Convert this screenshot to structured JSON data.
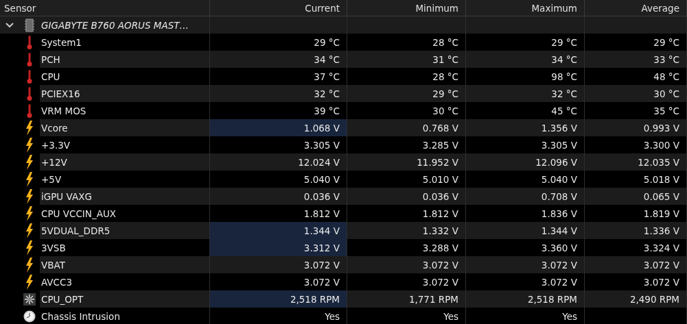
{
  "columns": [
    "Sensor",
    "Current",
    "Minimum",
    "Maximum",
    "Average"
  ],
  "groups": [
    {
      "name": "GIGABYTE B760 AORUS MAST…",
      "expanded": true,
      "children": [
        {
          "kind": "temperature",
          "name": "System1",
          "values": [
            "29 °C",
            "28 °C",
            "29 °C",
            "29 °C"
          ],
          "highlighted": false
        },
        {
          "kind": "temperature",
          "name": "PCH",
          "values": [
            "34 °C",
            "31 °C",
            "34 °C",
            "33 °C"
          ],
          "highlighted": false
        },
        {
          "kind": "temperature",
          "name": "CPU",
          "values": [
            "37 °C",
            "28 °C",
            "98 °C",
            "48 °C"
          ],
          "highlighted": false
        },
        {
          "kind": "temperature",
          "name": "PCIEX16",
          "values": [
            "32 °C",
            "29 °C",
            "32 °C",
            "30 °C"
          ],
          "highlighted": false
        },
        {
          "kind": "temperature",
          "name": "VRM MOS",
          "values": [
            "39 °C",
            "30 °C",
            "45 °C",
            "35 °C"
          ],
          "highlighted": false
        },
        {
          "kind": "voltage",
          "name": "Vcore",
          "values": [
            "1.068 V",
            "0.768 V",
            "1.356 V",
            "0.993 V"
          ],
          "highlighted": true
        },
        {
          "kind": "voltage",
          "name": "+3.3V",
          "values": [
            "3.305 V",
            "3.285 V",
            "3.305 V",
            "3.300 V"
          ],
          "highlighted": false
        },
        {
          "kind": "voltage",
          "name": "+12V",
          "values": [
            "12.024 V",
            "11.952 V",
            "12.096 V",
            "12.035 V"
          ],
          "highlighted": false
        },
        {
          "kind": "voltage",
          "name": "+5V",
          "values": [
            "5.040 V",
            "5.010 V",
            "5.040 V",
            "5.018 V"
          ],
          "highlighted": false
        },
        {
          "kind": "voltage",
          "name": "iGPU VAXG",
          "values": [
            "0.036 V",
            "0.036 V",
            "0.708 V",
            "0.065 V"
          ],
          "highlighted": false
        },
        {
          "kind": "voltage",
          "name": "CPU VCCIN_AUX",
          "values": [
            "1.812 V",
            "1.812 V",
            "1.836 V",
            "1.819 V"
          ],
          "highlighted": false
        },
        {
          "kind": "voltage",
          "name": "5VDUAL_DDR5",
          "values": [
            "1.344 V",
            "1.332 V",
            "1.344 V",
            "1.336 V"
          ],
          "highlighted": true
        },
        {
          "kind": "voltage",
          "name": "3VSB",
          "values": [
            "3.312 V",
            "3.288 V",
            "3.360 V",
            "3.324 V"
          ],
          "highlighted": true
        },
        {
          "kind": "voltage",
          "name": "VBAT",
          "values": [
            "3.072 V",
            "3.072 V",
            "3.072 V",
            "3.072 V"
          ],
          "highlighted": false
        },
        {
          "kind": "voltage",
          "name": "AVCC3",
          "values": [
            "3.072 V",
            "3.072 V",
            "3.072 V",
            "3.072 V"
          ],
          "highlighted": false
        },
        {
          "kind": "fan",
          "name": "CPU_OPT",
          "values": [
            "2,518 RPM",
            "1,771 RPM",
            "2,518 RPM",
            "2,490 RPM"
          ],
          "highlighted": true
        },
        {
          "kind": "intrusion",
          "name": "Chassis Intrusion",
          "values": [
            "Yes",
            "Yes",
            "Yes"
          ],
          "highlighted": false
        }
      ]
    }
  ]
}
